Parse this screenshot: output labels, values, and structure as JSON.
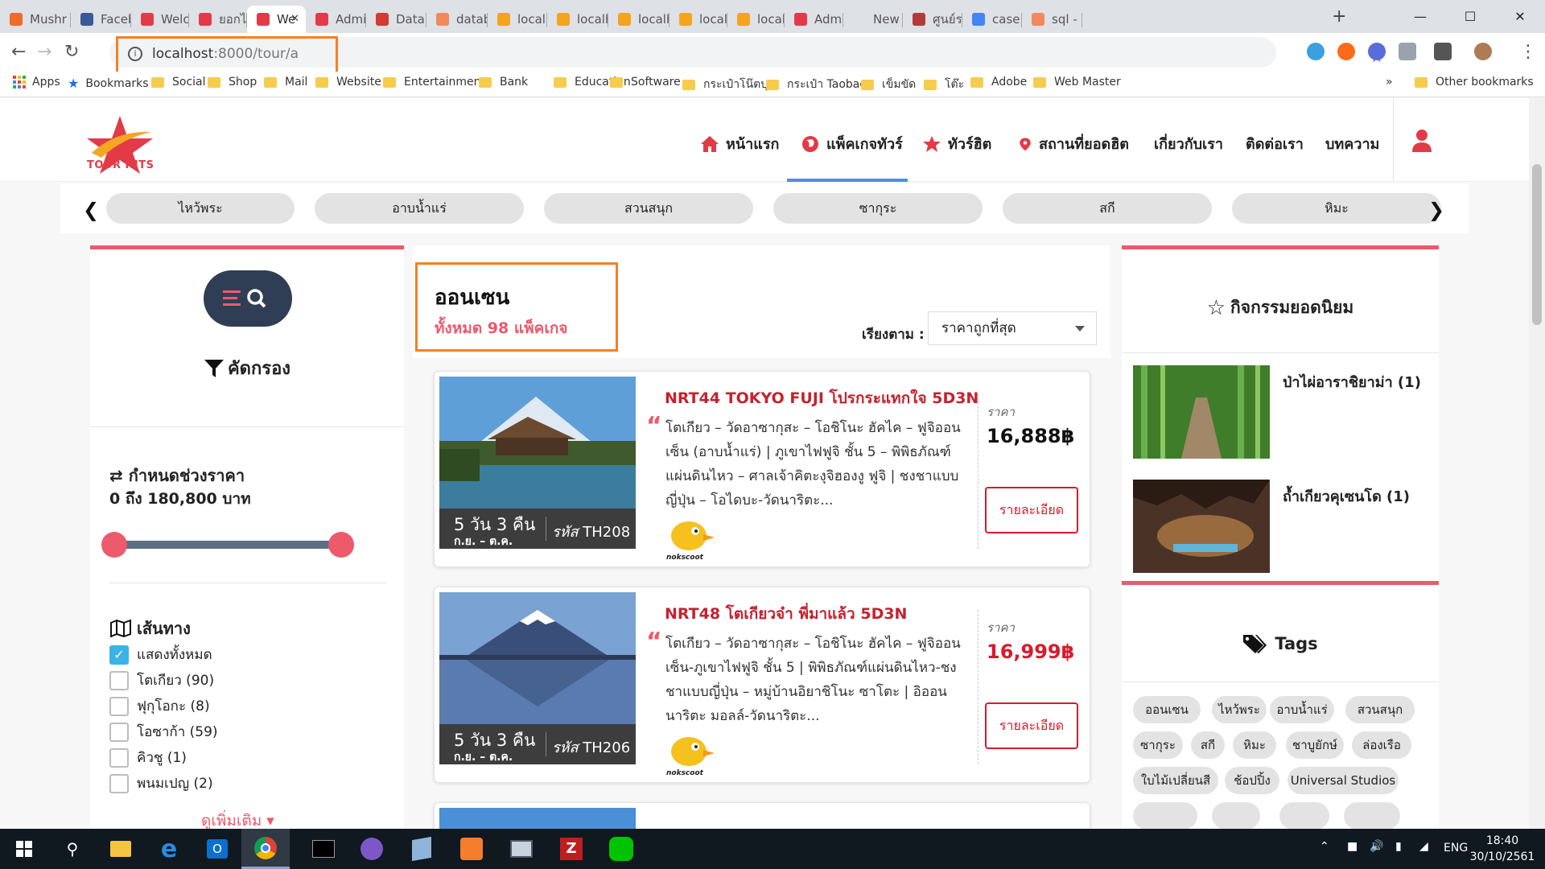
{
  "browser": {
    "tabs": [
      {
        "label": "Mushr",
        "active": false
      },
      {
        "label": "Facebo",
        "active": false
      },
      {
        "label": "Welco",
        "active": false
      },
      {
        "label": "ยอกไกโ",
        "active": false
      },
      {
        "label": "We",
        "active": true
      },
      {
        "label": "Admin",
        "active": false
      },
      {
        "label": "Datab",
        "active": false
      },
      {
        "label": "datab",
        "active": false
      },
      {
        "label": "localh",
        "active": false
      },
      {
        "label": "localh",
        "active": false
      },
      {
        "label": "localh",
        "active": false
      },
      {
        "label": "localh",
        "active": false
      },
      {
        "label": "localh",
        "active": false
      },
      {
        "label": "Admin",
        "active": false
      },
      {
        "label": "New Tab",
        "active": false
      },
      {
        "label": "ศูนย์รว",
        "active": false
      },
      {
        "label": "case v",
        "active": false
      },
      {
        "label": "sql - L",
        "active": false
      }
    ],
    "url_host": "localhost",
    "url_path": ":8000/tour/a",
    "bookmarks": [
      "Apps",
      "Bookmarks",
      "Social",
      "Shop",
      "Mail",
      "Website",
      "Entertainment",
      "Bank",
      "Education",
      "Software",
      "กระเป๋าโน๊ตบุต",
      "กระเป๋า Taobao",
      "เข็มขัด",
      "โต๊ะ",
      "Adobe",
      "Web Master"
    ],
    "bookmarks_more": "»",
    "other_bookmarks": "Other bookmarks"
  },
  "site": {
    "logo_text": "TOUR HITS",
    "nav": [
      "หน้าแรก",
      "แพ็คเกจทัวร์",
      "ทัวร์ฮิต",
      "สถานที่ยอดฮิต",
      "เกี่ยวกับเรา",
      "ติดต่อเรา",
      "บทความ"
    ],
    "categories": [
      "ไหว้พระ",
      "อาบน้ำแร่",
      "สวนสนุก",
      "ซากุระ",
      "สกี",
      "หิมะ"
    ],
    "colors": {
      "accent": "#ec5a6b",
      "navy": "#2f3e55",
      "nav_underline": "#4a8fe7",
      "highlight_box": "#f58025",
      "price_red": "#d81b2c"
    }
  },
  "sidebar": {
    "filter_title": "คัดกรอง",
    "price_title": "กำหนดช่วงราคา",
    "price_range": "0 ถึง 180,800 บาท",
    "route_title": "เส้นทาง",
    "routes": [
      {
        "label": "แสดงทั้งหมด",
        "checked": true
      },
      {
        "label": "โตเกียว (90)",
        "checked": false
      },
      {
        "label": "ฟุกุโอกะ (8)",
        "checked": false
      },
      {
        "label": "โอซาก้า (59)",
        "checked": false
      },
      {
        "label": "คิวชู (1)",
        "checked": false
      },
      {
        "label": "พนมเปญ (2)",
        "checked": false
      }
    ],
    "more": "ดูเพิ่มเติม"
  },
  "main": {
    "zone": "ออนเซน",
    "count": "ทั้งหมด 98 แพ็คเกจ",
    "sort_label": "เรียงตาม :",
    "sort_value": "ราคาถูกที่สุด",
    "cards": [
      {
        "title": "NRT44 TOKYO FUJI โปรกระแทกใจ 5D3N",
        "desc": "โตเกียว – วัดอาซากุสะ – โอชิโนะ ฮัคไค – ฟูจิออนเซ็น (อาบน้ำแร่) | ภูเขาไฟฟูจิ ชั้น 5 – พิพิธภัณฑ์แผ่นดินไหว – ศาลเจ้าคิตะงุจิฮองงู ฟูจิ | ชงชาแบบญี่ปุ่น – โอไดบะ-วัดนาริตะ...",
        "duration": "5 วัน 3 คืน",
        "months": "ก.ย. – ต.ค.",
        "code_label": "รหัส",
        "code": "TH208",
        "airline": "nokscoot",
        "price_label": "ราคา",
        "price": "16,888฿",
        "price_color": "#111111",
        "detail": "รายละเอียด"
      },
      {
        "title": "NRT48 โตเกียวจ๋า พี่มาแล้ว 5D3N",
        "desc": "โตเกียว – วัดอาซากุสะ – โอชิโนะ ฮัคไค – ฟูจิออนเซ็น-ภูเขาไฟฟูจิ ชั้น 5 | พิพิธภัณฑ์แผ่นดินไหว-ชงชาแบบญี่ปุ่น – หมู่บ้านอิยาชิโนะ ซาโตะ | อิออน นาริตะ มอลล์-วัดนาริตะ...",
        "duration": "5 วัน 3 คืน",
        "months": "ก.ย. – ต.ค.",
        "code_label": "รหัส",
        "code": "TH206",
        "airline": "nokscoot",
        "price_label": "ราคา",
        "price": "16,999฿",
        "price_color": "#d81b2c",
        "detail": "รายละเอียด"
      }
    ]
  },
  "right": {
    "activities_title": "กิจกรรมยอดนิยม",
    "activities": [
      {
        "name": "ป่าไผ่อาราชิยาม่า (1)"
      },
      {
        "name": "ถ้ำเกียวคุเซนโด (1)"
      }
    ],
    "tags_title": "Tags",
    "tags": [
      "ออนเซน",
      "ไหว้พระ",
      "อาบน้ำแร่",
      "สวนสนุก",
      "ซากุระ",
      "สกี",
      "หิมะ",
      "ชาบูยักษ์",
      "ล่องเรือ",
      "ใบไม้เปลี่ยนสี",
      "ช้อปปิ้ง",
      "Universal Studios"
    ]
  },
  "taskbar": {
    "lang": "ENG",
    "time": "18:40",
    "date": "30/10/2561"
  }
}
